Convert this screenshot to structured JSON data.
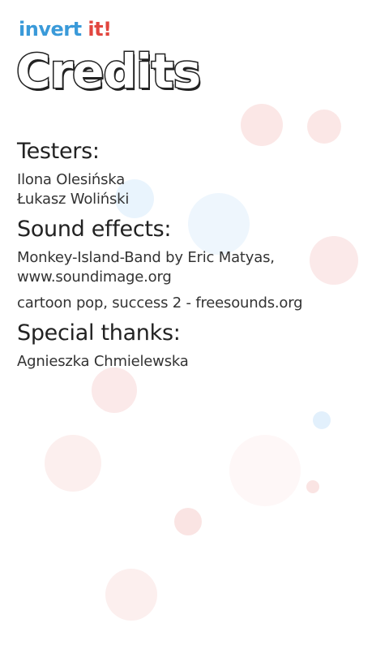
{
  "app": {
    "logo_word1": "invert",
    "logo_word2": "it!",
    "logo_color1": "#3a9ad9",
    "logo_color2": "#e2463f"
  },
  "page": {
    "title": "Credits"
  },
  "sections": {
    "testers": {
      "heading": "Testers:",
      "lines": [
        "Ilona Olesińska",
        "Łukasz Woliński"
      ]
    },
    "sound_effects": {
      "heading": "Sound effects:",
      "entry1": [
        "Monkey-Island-Band by Eric Matyas,",
        "www.soundimage.org"
      ],
      "entry2": [
        "cartoon pop, success 2 - freesounds.org"
      ]
    },
    "special_thanks": {
      "heading": "Special thanks:",
      "lines": [
        "Agnieszka Chmielewska"
      ]
    }
  },
  "colors": {
    "bubble_pink": "#f6c9c7",
    "bubble_blue": "#cfe6fa"
  }
}
